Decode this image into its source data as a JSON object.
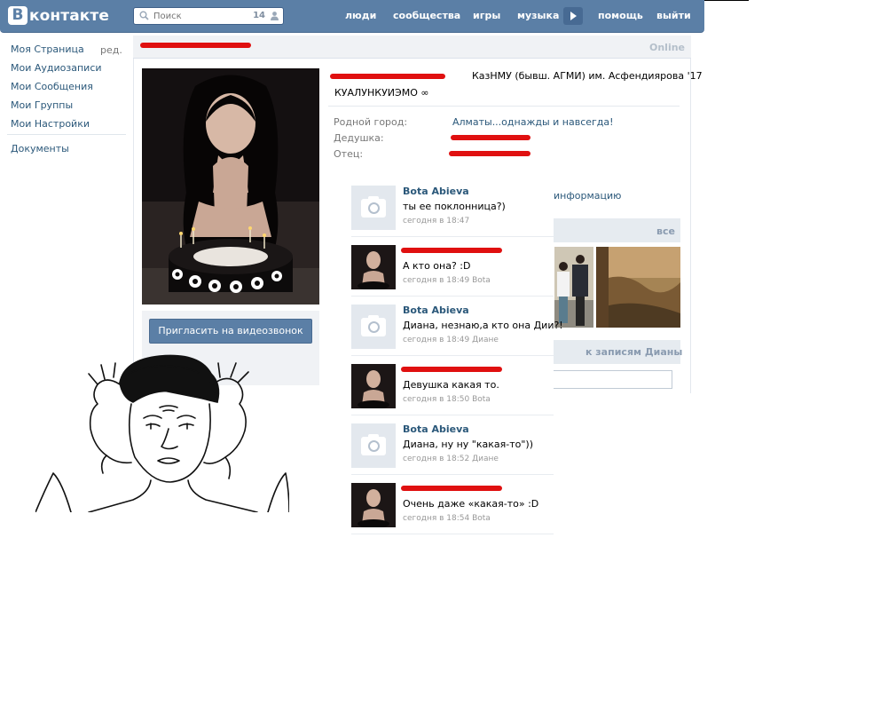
{
  "header": {
    "logo_letter": "В",
    "logo_text": "контакте",
    "search": {
      "placeholder": "Поиск",
      "count": "14"
    },
    "nav": [
      "люди",
      "сообщества",
      "игры",
      "музыка",
      "помощь",
      "выйти"
    ]
  },
  "left_menu": {
    "items": [
      "Моя Страница",
      "Мои Аудиозаписи",
      "Мои Сообщения",
      "Мои Группы",
      "Мои Настройки",
      "Документы"
    ],
    "edit_label": "ред."
  },
  "profile": {
    "status": "Online",
    "university": "КазНМУ (бывш. АГМИ) им. Асфендиярова '17",
    "activity": "КУАЛУНКУИЭМО ∞",
    "fields": [
      {
        "label": "Родной город:",
        "value": "Алматы...однажды и навсегда!"
      },
      {
        "label": "Дедушка:",
        "value": ""
      },
      {
        "label": "Отец:",
        "value": ""
      }
    ],
    "more_info_link": "информацию",
    "invite_button": "Пригласить на видеозвонок",
    "photos_all_label": "все",
    "wall_label": "к записям Дианы"
  },
  "comments": [
    {
      "author": "Bota Abieva",
      "text": "ты ее поклонница?)",
      "time": "сегодня в 18:47",
      "avatar": "camera-icon"
    },
    {
      "author": "",
      "text": "А кто она? :D",
      "time": "сегодня в 18:49 Bota",
      "avatar": "profile-photo"
    },
    {
      "author": "Bota Abieva",
      "text": "Диана, незнаю,а кто она Дии?!",
      "time": "сегодня в 18:49 Диане",
      "avatar": "camera-icon"
    },
    {
      "author": "",
      "text": "Девушка какая то.",
      "time": "сегодня в 18:50 Bota",
      "avatar": "profile-photo"
    },
    {
      "author": "Bota Abieva",
      "text": "Диана, ну ну \"какая-то\"))",
      "time": "сегодня в 18:52 Диане",
      "avatar": "camera-icon"
    },
    {
      "author": "",
      "text": "Очень даже «какая-то» :D",
      "time": "сегодня в 18:54 Bota",
      "avatar": "profile-photo"
    }
  ],
  "colors": {
    "header_blue": "#5b7fa6",
    "link_blue": "#2b587a",
    "redaction_red": "#e01010"
  }
}
